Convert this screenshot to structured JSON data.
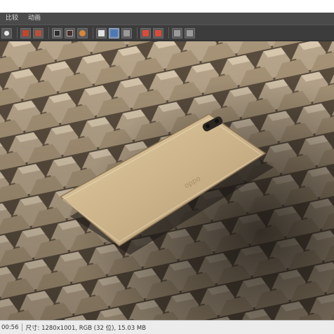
{
  "menu": {
    "items": [
      "比较",
      "动画"
    ]
  },
  "toolbar": {
    "buttons": [
      "zoom-icon",
      "open-red-icon",
      "save-red-icon",
      "image-view-icon",
      "thumb-view-icon",
      "browser-icon",
      "ab-compare-icon",
      "grid-view-icon",
      "split-view-icon",
      "a-red-icon",
      "b-red-icon",
      "slide-icon",
      "film-icon"
    ]
  },
  "status": {
    "time": "00:56",
    "info": "尺寸: 1280x1001, RGB (32 位), 15.03 MB"
  },
  "colors": {
    "menubar": "#4a4a4a",
    "toolbar": "#3c3c3c",
    "statusbar": "#ececec",
    "phone": "#cdb48a"
  }
}
